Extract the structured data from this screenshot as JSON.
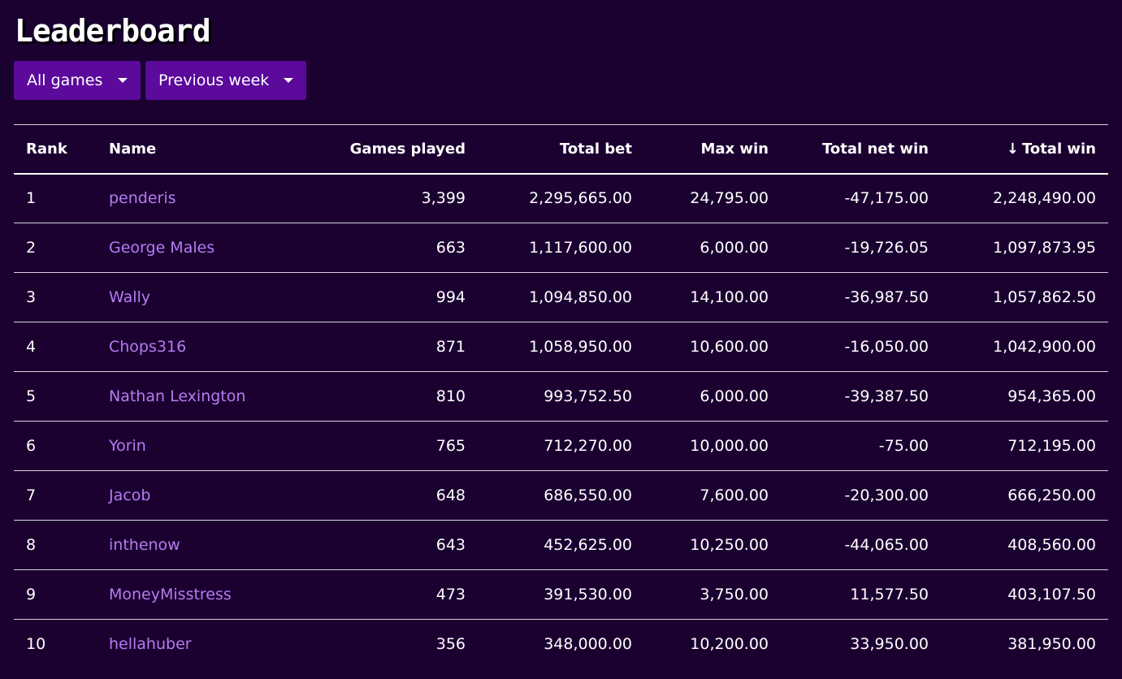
{
  "header": {
    "title": "Leaderboard"
  },
  "filters": {
    "game": "All games",
    "period": "Previous week"
  },
  "table": {
    "columns": {
      "rank": "Rank",
      "name": "Name",
      "games_played": "Games played",
      "total_bet": "Total bet",
      "max_win": "Max win",
      "total_net_win": "Total net win",
      "total_win": "Total win"
    },
    "sort_indicator": "↓",
    "rows": [
      {
        "rank": "1",
        "name": "penderis",
        "games_played": "3,399",
        "total_bet": "2,295,665.00",
        "max_win": "24,795.00",
        "total_net_win": "-47,175.00",
        "total_win": "2,248,490.00"
      },
      {
        "rank": "2",
        "name": "George Males",
        "games_played": "663",
        "total_bet": "1,117,600.00",
        "max_win": "6,000.00",
        "total_net_win": "-19,726.05",
        "total_win": "1,097,873.95"
      },
      {
        "rank": "3",
        "name": "Wally",
        "games_played": "994",
        "total_bet": "1,094,850.00",
        "max_win": "14,100.00",
        "total_net_win": "-36,987.50",
        "total_win": "1,057,862.50"
      },
      {
        "rank": "4",
        "name": "Chops316",
        "games_played": "871",
        "total_bet": "1,058,950.00",
        "max_win": "10,600.00",
        "total_net_win": "-16,050.00",
        "total_win": "1,042,900.00"
      },
      {
        "rank": "5",
        "name": "Nathan Lexington",
        "games_played": "810",
        "total_bet": "993,752.50",
        "max_win": "6,000.00",
        "total_net_win": "-39,387.50",
        "total_win": "954,365.00"
      },
      {
        "rank": "6",
        "name": "Yorin",
        "games_played": "765",
        "total_bet": "712,270.00",
        "max_win": "10,000.00",
        "total_net_win": "-75.00",
        "total_win": "712,195.00"
      },
      {
        "rank": "7",
        "name": "Jacob",
        "games_played": "648",
        "total_bet": "686,550.00",
        "max_win": "7,600.00",
        "total_net_win": "-20,300.00",
        "total_win": "666,250.00"
      },
      {
        "rank": "8",
        "name": "inthenow",
        "games_played": "643",
        "total_bet": "452,625.00",
        "max_win": "10,250.00",
        "total_net_win": "-44,065.00",
        "total_win": "408,560.00"
      },
      {
        "rank": "9",
        "name": "MoneyMisstress",
        "games_played": "473",
        "total_bet": "391,530.00",
        "max_win": "3,750.00",
        "total_net_win": "11,577.50",
        "total_win": "403,107.50"
      },
      {
        "rank": "10",
        "name": "hellahuber",
        "games_played": "356",
        "total_bet": "348,000.00",
        "max_win": "10,200.00",
        "total_net_win": "33,950.00",
        "total_win": "381,950.00"
      }
    ]
  },
  "colors": {
    "background": "#1b0130",
    "dropdown": "#5b0a9c",
    "link": "#b57cf2",
    "text": "#ffffff"
  }
}
